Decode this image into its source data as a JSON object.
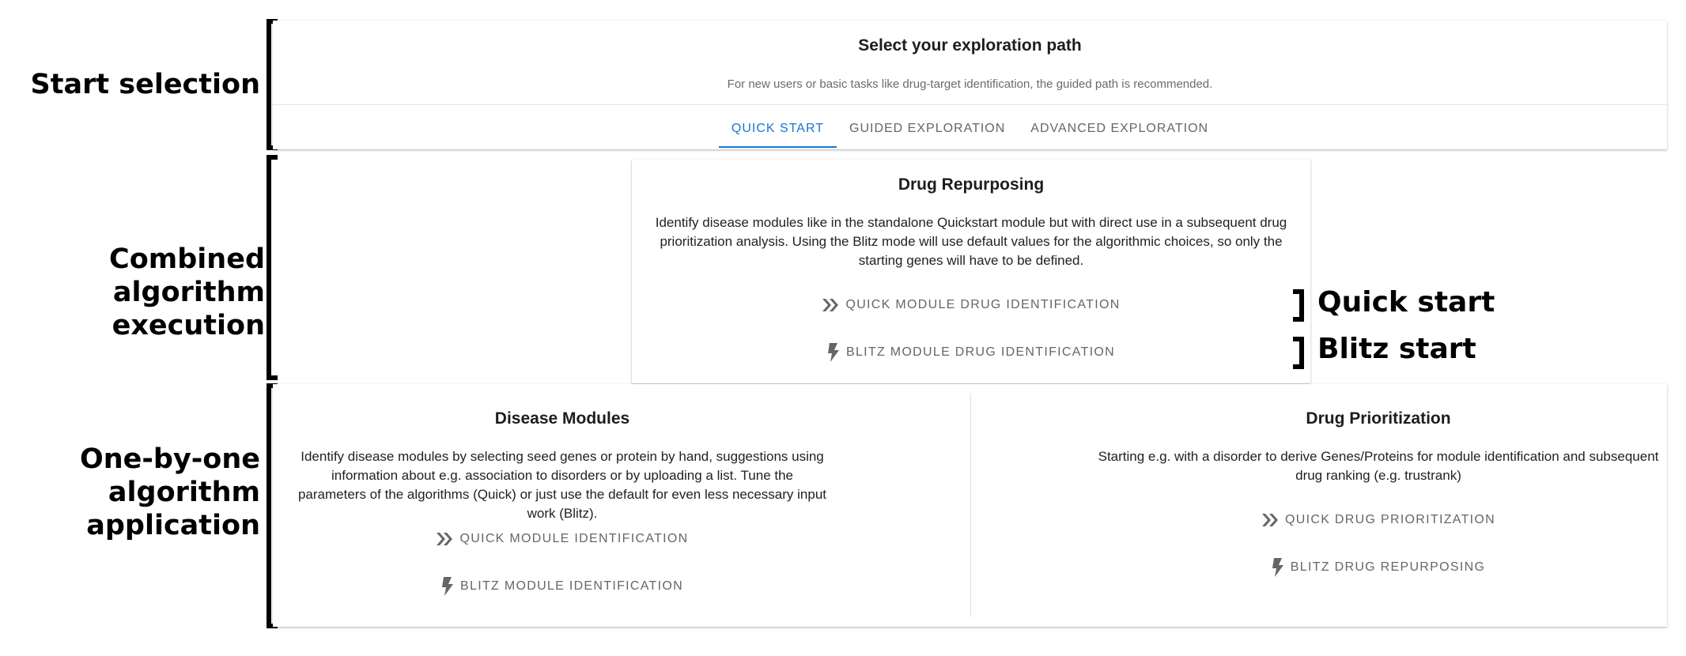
{
  "annotations": {
    "start_selection": "Start selection",
    "combined_line1": "Combined algorithm",
    "combined_line2": "execution",
    "onebyone_line1": "One-by-one",
    "onebyone_line2": "algorithm",
    "onebyone_line3": "application",
    "quick_start": "Quick start",
    "blitz_start": "Blitz start"
  },
  "path_card": {
    "title": "Select your exploration path",
    "subtitle": "For new users or basic tasks like drug-target identification, the guided path is recommended.",
    "tabs": [
      {
        "label": "Quick Start",
        "active": true
      },
      {
        "label": "Guided Exploration",
        "active": false
      },
      {
        "label": "Advanced Exploration",
        "active": false
      }
    ]
  },
  "repurposing_card": {
    "title": "Drug Repurposing",
    "description": "Identify disease modules like in the standalone Quickstart module but with direct use in a subsequent drug prioritization analysis. Using the Blitz mode will use default values for the algorithmic choices, so only the starting genes will have to be defined.",
    "quick_button": "Quick Module Drug Identification",
    "blitz_button": "Blitz Module Drug Identification"
  },
  "modules_card": {
    "title": "Disease Modules",
    "description": "Identify disease modules by selecting seed genes or protein by hand, suggestions using information about e.g. association to disorders or by uploading a list. Tune the parameters of the algorithms (Quick) or just use the default for even less necessary input work (Blitz).",
    "quick_button": "Quick Module Identification",
    "blitz_button": "Blitz Module Identification"
  },
  "prioritization_card": {
    "title": "Drug Prioritization",
    "description": "Starting e.g. with a disorder to derive Genes/Proteins for module identification and subsequent drug ranking (e.g. trustrank)",
    "quick_button": "Quick Drug Prioritization",
    "blitz_button": "Blitz Drug Repurposing"
  },
  "colors": {
    "accent": "#1976d2",
    "muted": "#666666"
  },
  "icons": {
    "quick": "double-chevron-right-icon",
    "blitz": "lightning-bolt-icon"
  }
}
